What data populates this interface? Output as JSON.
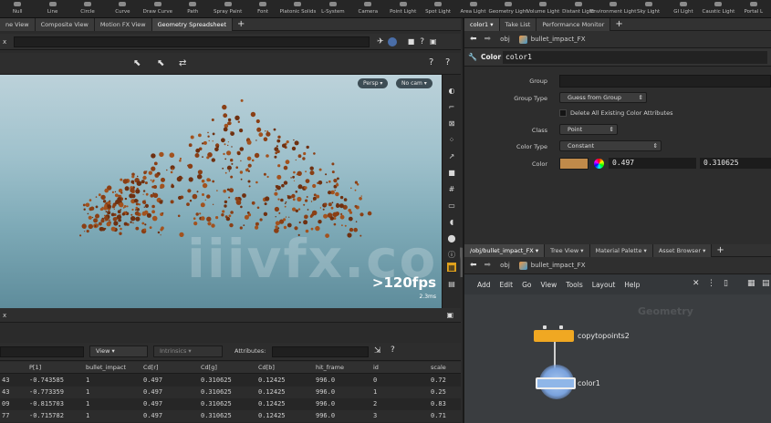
{
  "shelf": {
    "tools": [
      "Null",
      "Line",
      "Circle",
      "Curve",
      "Draw Curve",
      "Path",
      "Spray Paint",
      "Font",
      "Platonic Solids",
      "L-System",
      "Camera",
      "Point Light",
      "Spot Light",
      "Area Light",
      "Geometry Light",
      "Volume Light",
      "Distant Light",
      "Environment Light",
      "Sky Light",
      "GI Light",
      "Caustic Light",
      "Portal L"
    ]
  },
  "left_tabs": [
    "ne View",
    "Composite View",
    "Motion FX View",
    "Geometry Spreadsheet"
  ],
  "left_path": "x",
  "viewport": {
    "camera_menu": "Persp",
    "cam_menu": "No cam",
    "fps": ">120fps",
    "sub_fps": "2.3ms",
    "watermark": "iiivfx.com"
  },
  "spreadsheet": {
    "path": "x",
    "view_label": "View",
    "intrinsics_label": "Intrinsics",
    "attributes_label": "Attributes:",
    "columns": [
      "",
      "P[1]",
      "bullet_impact",
      "Cd[r]",
      "Cd[g]",
      "Cd[b]",
      "hit_frame",
      "id",
      "scale"
    ],
    "rows": [
      [
        "43",
        "-0.743585",
        "1",
        "0.497",
        "0.310625",
        "0.12425",
        "996.0",
        "0",
        "0.72"
      ],
      [
        "43",
        "-0.773359",
        "1",
        "0.497",
        "0.310625",
        "0.12425",
        "996.0",
        "1",
        "0.25"
      ],
      [
        "09",
        "-0.815703",
        "1",
        "0.497",
        "0.310625",
        "0.12425",
        "996.0",
        "2",
        "0.83"
      ],
      [
        "77",
        "-0.715782",
        "1",
        "0.497",
        "0.310625",
        "0.12425",
        "996.0",
        "3",
        "0.71"
      ]
    ]
  },
  "param_tabs": [
    "color1",
    "Take List",
    "Performance Monitor"
  ],
  "param_path": {
    "context": "obj",
    "node": "bullet_impact_FX"
  },
  "params": {
    "node_type": "Color",
    "node_name": "color1",
    "group_label": "Group",
    "group_type_label": "Group Type",
    "group_type_value": "Guess from Group",
    "delete_label": "Delete All Existing Color Attributes",
    "class_label": "Class",
    "class_value": "Point",
    "color_type_label": "Color Type",
    "color_type_value": "Constant",
    "color_label": "Color",
    "color_r": "0.497",
    "color_g": "0.310625",
    "swatch": "#c08a4a"
  },
  "network_tabs": [
    "/obj/bullet_impact_FX",
    "Tree View",
    "Material Palette",
    "Asset Browser"
  ],
  "network_path": {
    "context": "obj",
    "node": "bullet_impact_FX"
  },
  "network_menu": [
    "Add",
    "Edit",
    "Go",
    "View",
    "Tools",
    "Layout",
    "Help"
  ],
  "network_watermark": "Geometry",
  "nodes": {
    "copy": "copytopoints2",
    "color": "color1"
  },
  "colors": {
    "accent": "#f0a822",
    "node_blue": "#8fb6e8"
  }
}
